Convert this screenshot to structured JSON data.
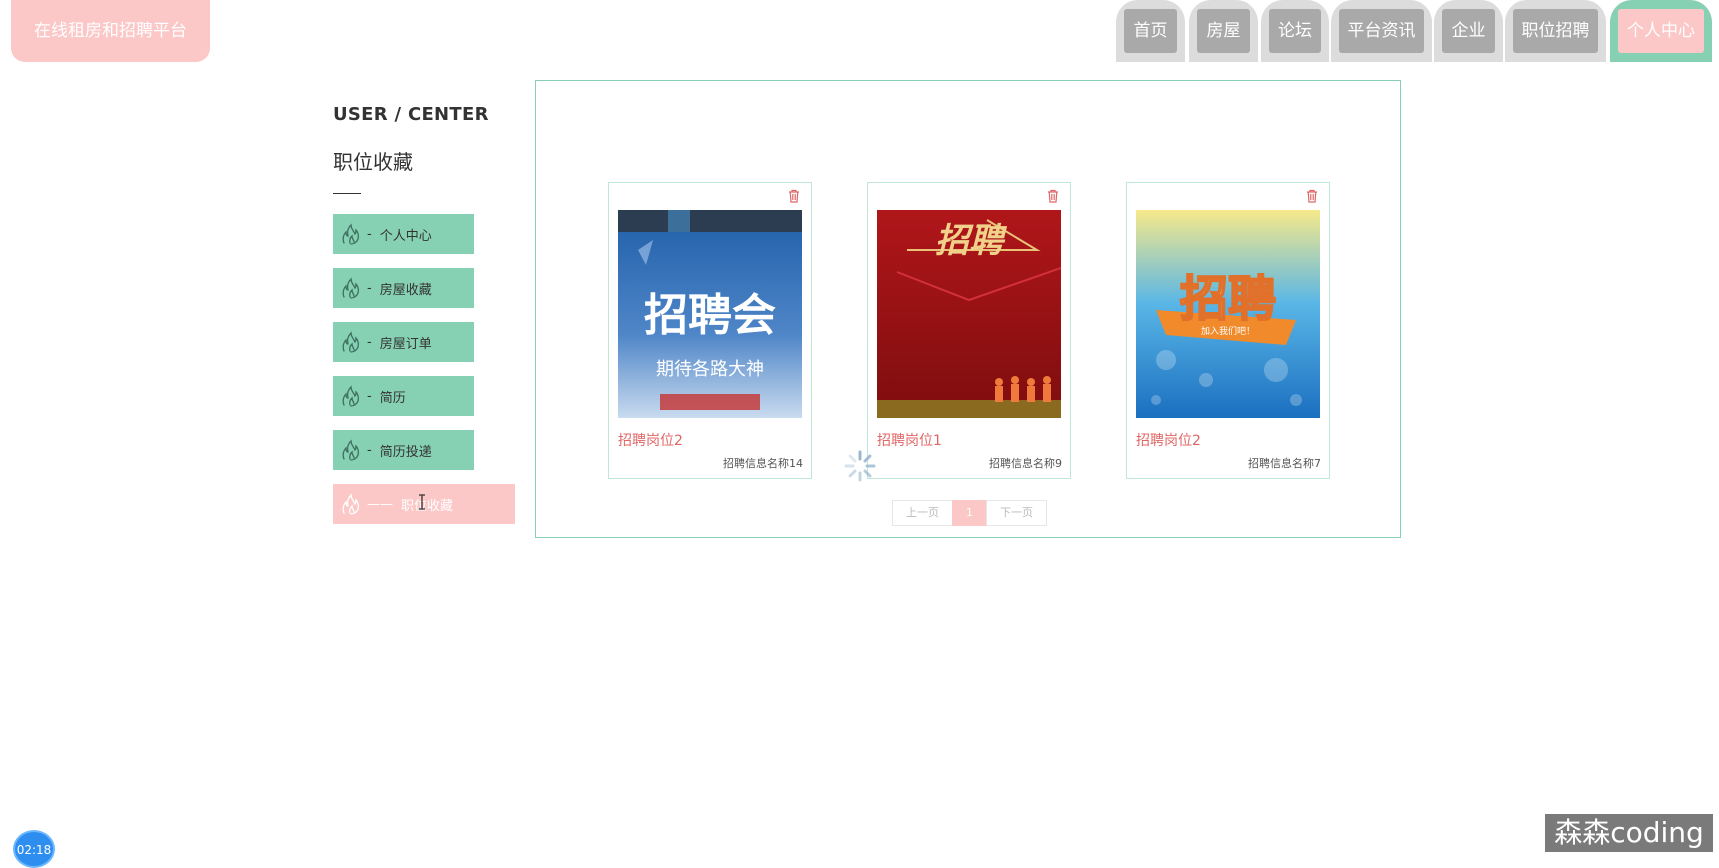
{
  "header": {
    "logo_text": "在线租房和招聘平台",
    "nav": [
      {
        "label": "首页",
        "active": false
      },
      {
        "label": "房屋",
        "active": false
      },
      {
        "label": "论坛",
        "active": false
      },
      {
        "label": "平台资讯",
        "active": false
      },
      {
        "label": "企业",
        "active": false
      },
      {
        "label": "职位招聘",
        "active": false
      },
      {
        "label": "个人中心",
        "active": true
      }
    ]
  },
  "sidebar": {
    "caption": "USER / CENTER",
    "title": "职位收藏",
    "menu": [
      {
        "label": "个人中心",
        "dash": "-"
      },
      {
        "label": "房屋收藏",
        "dash": "-"
      },
      {
        "label": "房屋订单",
        "dash": "-"
      },
      {
        "label": "简历",
        "dash": "-"
      },
      {
        "label": "简历投递",
        "dash": "-"
      },
      {
        "label": "职位收藏",
        "dash": "——",
        "active": true
      }
    ]
  },
  "favorites": [
    {
      "name": "招聘岗位2",
      "subtitle": "招聘信息名称14",
      "poster_text": "招聘会",
      "poster_sub": "期待各路大神"
    },
    {
      "name": "招聘岗位1",
      "subtitle": "招聘信息名称9",
      "poster_text": "招聘"
    },
    {
      "name": "招聘岗位2",
      "subtitle": "招聘信息名称7",
      "poster_text": "招聘",
      "poster_sub": "加入我们吧！"
    }
  ],
  "pagination": {
    "prev": "上一页",
    "current": "1",
    "next": "下一页"
  },
  "overlay": {
    "timer": "02:18",
    "watermark": "森森coding"
  },
  "colors": {
    "green": "#86d0b4",
    "pink": "#fbc7c7",
    "gray_tab": "#a9a9a9",
    "red_text": "#e06666"
  },
  "icons": {
    "menu": "flame-icon",
    "card_action": "trash-icon",
    "loading": "spinner-icon"
  }
}
